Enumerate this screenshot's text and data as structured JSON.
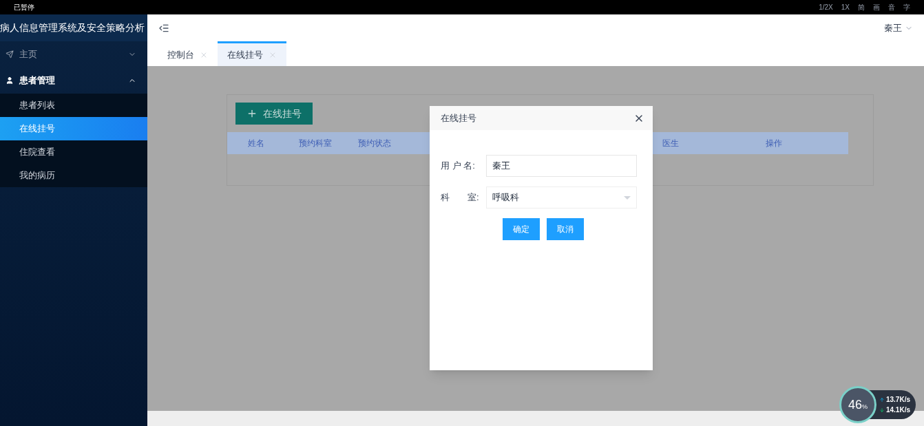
{
  "recorder_bar": {
    "status": "已暂停",
    "controls": [
      "1/2X",
      "1X",
      "简",
      "画",
      "音",
      "字"
    ]
  },
  "sidebar": {
    "title": "病人信息管理系统及安全策略分析",
    "menu": [
      {
        "label": "主页",
        "expanded": false
      },
      {
        "label": "患者管理",
        "expanded": true,
        "children": [
          {
            "label": "患者列表",
            "selected": false
          },
          {
            "label": "在线挂号",
            "selected": true
          },
          {
            "label": "住院查看",
            "selected": false
          },
          {
            "label": "我的病历",
            "selected": false
          }
        ]
      }
    ]
  },
  "header": {
    "user": "秦王"
  },
  "tabs": [
    {
      "label": "控制台",
      "selected": false
    },
    {
      "label": "在线挂号",
      "selected": true
    }
  ],
  "page": {
    "add_button": "在线挂号",
    "table": {
      "columns": [
        "姓名",
        "预约科室",
        "预约状态",
        "医生",
        "操作"
      ]
    }
  },
  "dialog": {
    "title": "在线挂号",
    "fields": [
      {
        "label": "用 户 名:",
        "kind": "text",
        "value": "秦王"
      },
      {
        "label": "科　　室:",
        "kind": "select",
        "value": "呼吸科"
      }
    ],
    "buttons": [
      "确定",
      "取消"
    ]
  },
  "speed_widget": {
    "percent": "46",
    "unit": "%",
    "upload": "13.7K/s",
    "download": "14.1K/s"
  }
}
